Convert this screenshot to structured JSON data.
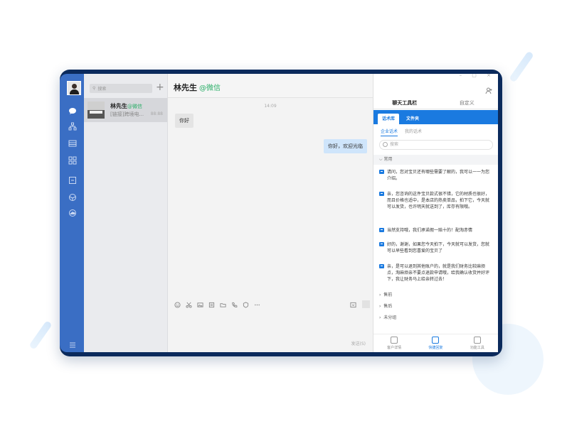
{
  "nav": {
    "icons": [
      "chat-icon",
      "org-chart-icon",
      "table-icon",
      "apps-grid-icon",
      "minus-box-icon",
      "cube-icon",
      "cloud-icon",
      "menu-icon"
    ]
  },
  "conversations": {
    "search_placeholder": "搜索",
    "add_symbol": "+",
    "items": [
      {
        "name": "林先生",
        "tag": "@微信",
        "preview": "[链接]跨境电...",
        "time": "88:88"
      }
    ]
  },
  "chat": {
    "contact_name": "林先生",
    "contact_tag": "@微信",
    "timestamp": "14:09",
    "messages": [
      {
        "side": "left",
        "text": "你好"
      },
      {
        "side": "right",
        "text": "你好，欢迎光临"
      }
    ],
    "toolbar": [
      "emoji-icon",
      "scissors-icon",
      "image-icon",
      "file-icon",
      "folder-icon",
      "phone-icon",
      "shield-icon",
      "more-icon"
    ],
    "send_label": "发送(S)"
  },
  "tools": {
    "window_controls": "– ▢ ×",
    "top_tabs": [
      {
        "label": "聊天工具栏",
        "active": true
      },
      {
        "label": "自定义",
        "active": false
      }
    ],
    "blue_tabs": [
      {
        "label": "话术库",
        "active": true
      },
      {
        "label": "文件夹",
        "active": false
      }
    ],
    "sub_tabs": [
      {
        "label": "企业话术",
        "active": true
      },
      {
        "label": "我的话术",
        "active": false
      }
    ],
    "search_placeholder": "搜索",
    "group_open": "常用",
    "scripts": [
      "请问，您对宝贝还有哪些需要了解的，我可以一一为您介绍。",
      "亲，您咨询的这件宝贝款式很不错，它的材质也很好，而且价格也适中，是本店的热卖单品，拍下它，今天就可以发货，也许明天就送到了，库存有限哦。",
      "当然支持哦，我们承诺假一赔十的！配淘赤情",
      "好的，谢谢，如果您今天拍下，今天就可以发货，您就可以早些看到您喜爱的宝贝了",
      "亲，是可以退到其他账户的，就是我们财务比较麻烦点，淘麻烦亲不要点退款申请哦，给我确认收货并好评下，我让财务马上给亲转过去！"
    ],
    "groups_closed": [
      "售前",
      "售后",
      "未分组"
    ],
    "bottom_nav": [
      {
        "label": "客户详情",
        "active": false
      },
      {
        "label": "快捷回复",
        "active": true
      },
      {
        "label": "功能工具",
        "active": false
      }
    ]
  }
}
